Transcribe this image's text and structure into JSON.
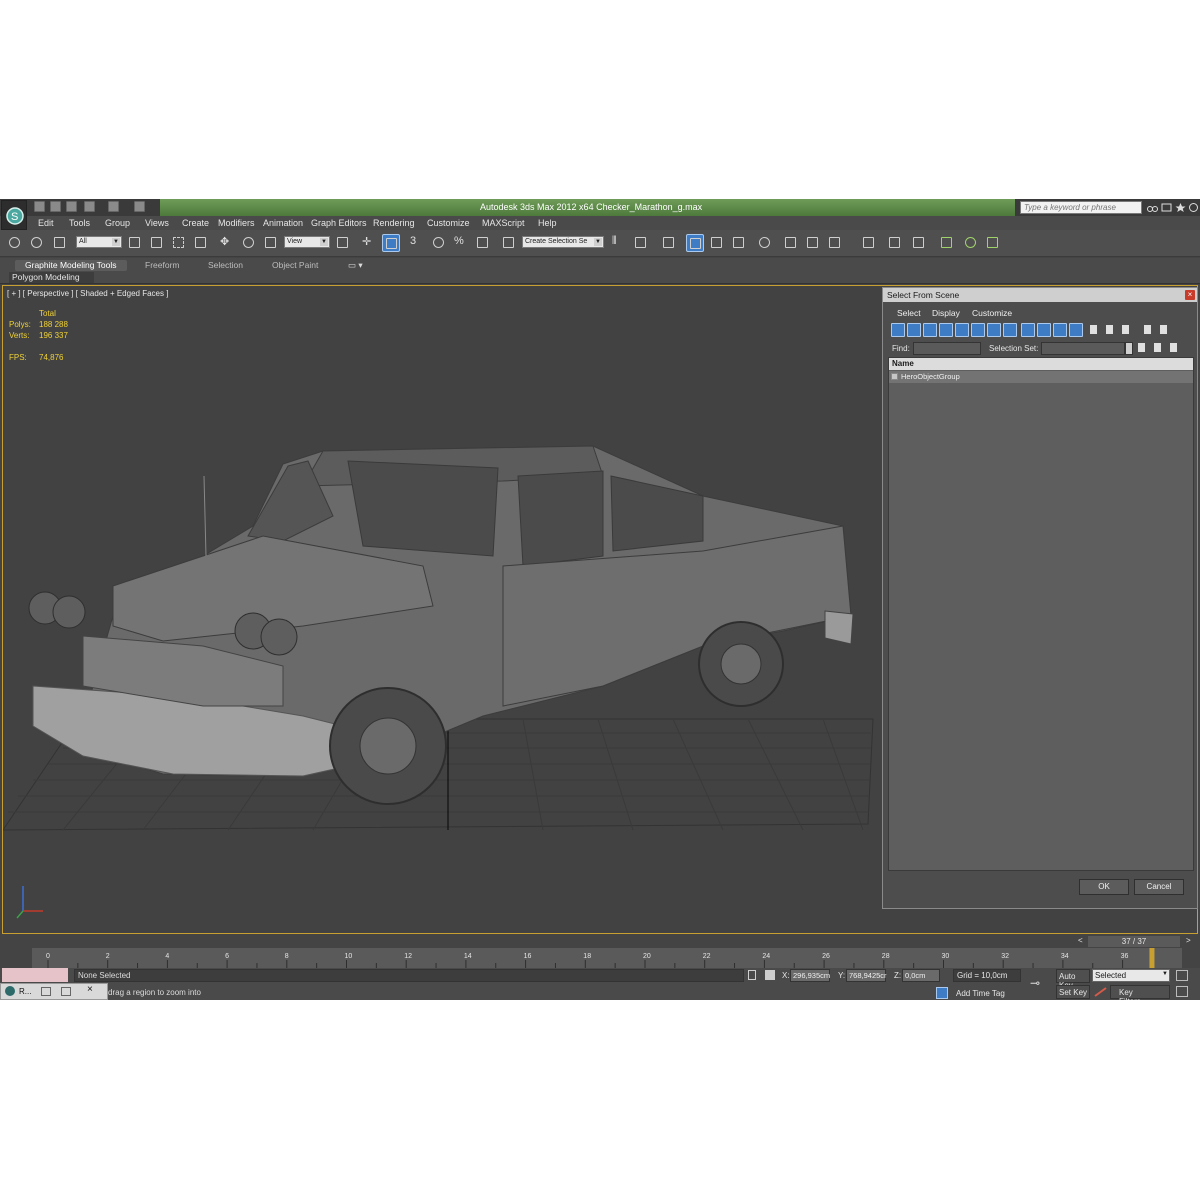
{
  "window": {
    "title": "Autodesk 3ds Max  2012 x64      Checker_Marathon_g.max",
    "search_placeholder": "Type a keyword or phrase",
    "accent_color": "#5a8a46"
  },
  "menu": {
    "items": [
      "Edit",
      "Tools",
      "Group",
      "Views",
      "Create",
      "Modifiers",
      "Animation",
      "Graph Editors",
      "Rendering",
      "Customize",
      "MAXScript",
      "Help"
    ]
  },
  "toolbar": {
    "filter_value": "All",
    "view_value": "View",
    "three_label": "3",
    "selection_set_placeholder": "Create Selection Se"
  },
  "ribbon": {
    "tabs": [
      "Graphite Modeling Tools",
      "Freeform",
      "Selection",
      "Object Paint"
    ],
    "sub_label": "Polygon Modeling"
  },
  "viewport": {
    "label": "[ + ] [ Perspective ] [ Shaded + Edged Faces ]",
    "stats": {
      "total_label": "Total",
      "polys_label": "Polys:",
      "polys_value": "188 288",
      "verts_label": "Verts:",
      "verts_value": "196 337",
      "fps_label": "FPS:",
      "fps_value": "74,876"
    }
  },
  "dialog": {
    "title": "Select From Scene",
    "menu": [
      "Select",
      "Display",
      "Customize"
    ],
    "find_label": "Find:",
    "selection_set_label": "Selection Set:",
    "column_name": "Name",
    "rows": [
      "HeroObjectGroup"
    ],
    "ok_label": "OK",
    "cancel_label": "Cancel"
  },
  "timeline": {
    "counter": "37 / 37",
    "prev": "<",
    "next": ">",
    "ticks": [
      "0",
      "2",
      "4",
      "6",
      "8",
      "10",
      "12",
      "14",
      "16",
      "18",
      "20",
      "22",
      "24",
      "26",
      "28",
      "30",
      "32",
      "34",
      "36"
    ],
    "current_frame": 37,
    "total_frames": 37
  },
  "status": {
    "selection_text": "None Selected",
    "prompt_text": "drag a region to zoom into",
    "taskbar_label": "R...",
    "x_label": "X:",
    "x_value": "296,935cm",
    "y_label": "Y:",
    "y_value": "768,9425cr",
    "z_label": "Z:",
    "z_value": "0,0cm",
    "grid_text": "Grid = 10,0cm",
    "add_time_tag": "Add Time Tag",
    "auto_key": "Auto Key",
    "set_key": "Set Key",
    "selected_value": "Selected",
    "key_filters": "Key Filters..."
  }
}
